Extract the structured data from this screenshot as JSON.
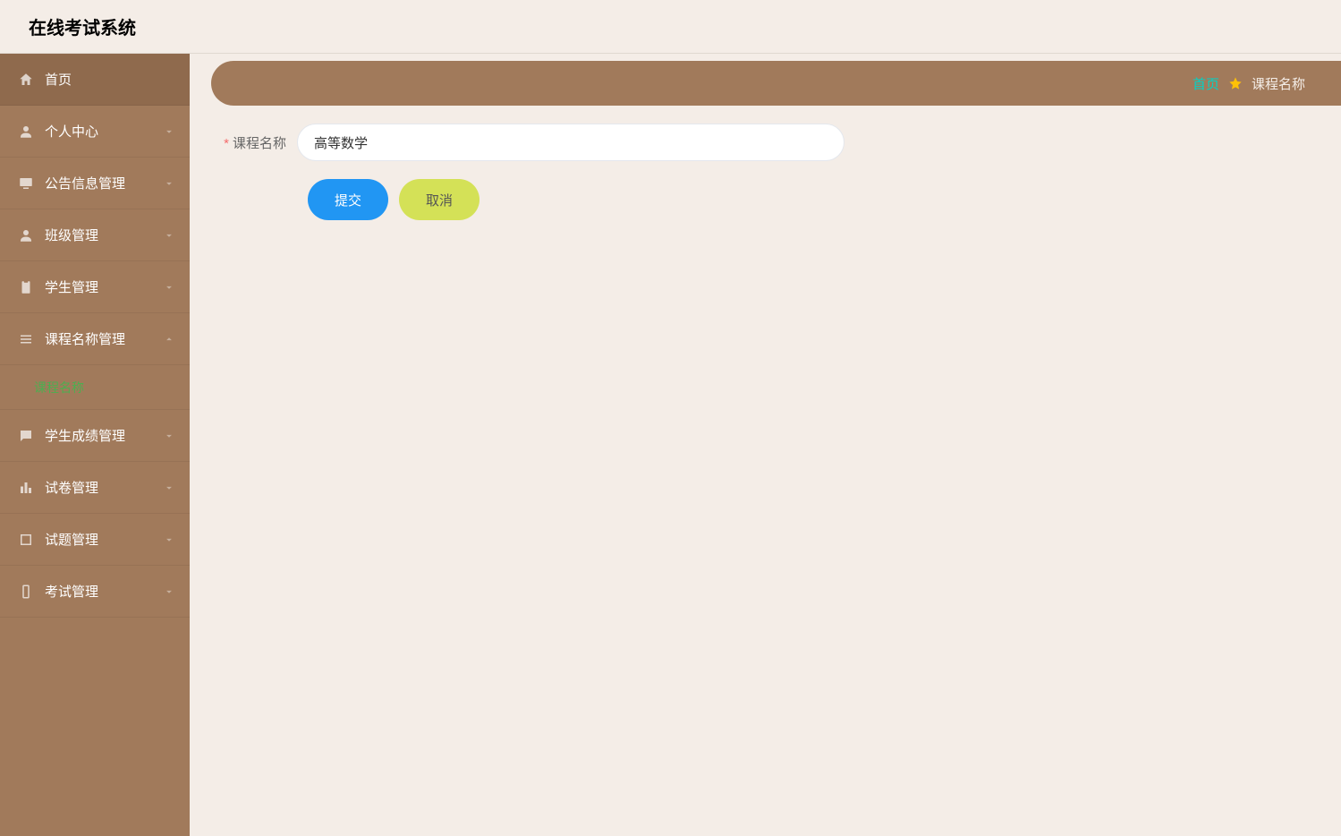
{
  "header": {
    "title": "在线考试系统"
  },
  "sidebar": {
    "items": [
      {
        "label": "首页",
        "icon": "home",
        "expandable": false,
        "active": true
      },
      {
        "label": "个人中心",
        "icon": "user",
        "expandable": true,
        "expanded": false
      },
      {
        "label": "公告信息管理",
        "icon": "monitor",
        "expandable": true,
        "expanded": false
      },
      {
        "label": "班级管理",
        "icon": "user",
        "expandable": true,
        "expanded": false
      },
      {
        "label": "学生管理",
        "icon": "clipboard",
        "expandable": true,
        "expanded": false
      },
      {
        "label": "课程名称管理",
        "icon": "list",
        "expandable": true,
        "expanded": true,
        "children": [
          {
            "label": "课程名称"
          }
        ]
      },
      {
        "label": "学生成绩管理",
        "icon": "chat",
        "expandable": true,
        "expanded": false
      },
      {
        "label": "试卷管理",
        "icon": "bar-chart",
        "expandable": true,
        "expanded": false
      },
      {
        "label": "试题管理",
        "icon": "crop",
        "expandable": true,
        "expanded": false
      },
      {
        "label": "考试管理",
        "icon": "phone",
        "expandable": true,
        "expanded": false
      }
    ]
  },
  "breadcrumb": {
    "home": "首页",
    "current": "课程名称"
  },
  "form": {
    "field_label": "课程名称",
    "field_value": "高等数学",
    "submit_label": "提交",
    "cancel_label": "取消"
  }
}
